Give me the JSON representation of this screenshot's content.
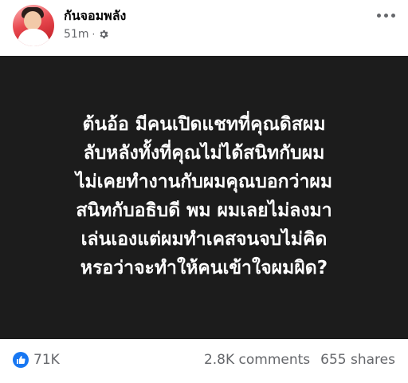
{
  "post": {
    "author": "กันจอมพลัง",
    "time": "51m",
    "separator": "·",
    "privacy_icon": "settings-gear-icon",
    "more_icon": "more-horizontal-icon",
    "text_lines": [
      "ต้นอ้อ มีคนเปิดแชทที่คุณดิสผม",
      "ลับหลังทั้งที่คุณไม่ได้สนิทกับผม",
      "ไม่เคยทำงานกับผมคุณบอกว่าผม",
      "สนิทกับอธิบดี พม ผมเลยไม่ลงมา",
      "เล่นเองแต่ผมทำเคสจนจบไม่คิด",
      "หรอว่าจะทำให้คนเข้าใจผมผิด?"
    ],
    "background_color": "#1c1c1c",
    "text_color": "#ffffff"
  },
  "footer": {
    "like_icon": "like-thumb-icon",
    "reaction_count": "71K",
    "comments": "2.8K comments",
    "shares": "655 shares"
  },
  "colors": {
    "accent": "#1877f2",
    "secondary_text": "#65676b"
  }
}
